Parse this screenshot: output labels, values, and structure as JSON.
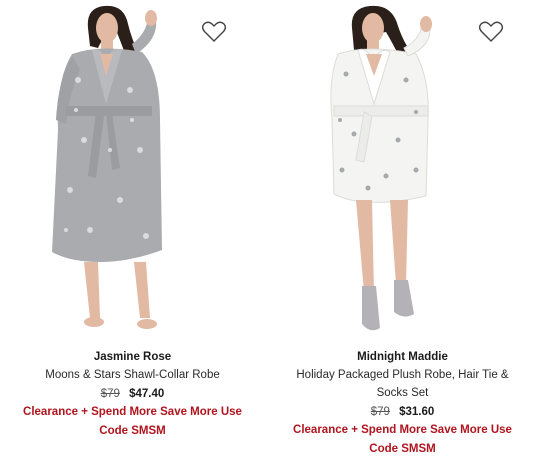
{
  "products": [
    {
      "brand": "Jasmine Rose",
      "name": "Moons & Stars Shawl-Collar Robe",
      "price_was": "$79",
      "price_now": "$47.40",
      "promo_line1": "Clearance + Spend More Save More Use",
      "promo_line2": "Code SMSM",
      "favorite_icon": "heart-outline-icon"
    },
    {
      "brand": "Midnight Maddie",
      "name_line1": "Holiday Packaged Plush Robe, Hair Tie &",
      "name_line2": "Socks Set",
      "price_was": "$79",
      "price_now": "$31.60",
      "promo_line1": "Clearance + Spend More Save More Use",
      "promo_line2": "Code SMSM",
      "favorite_icon": "heart-outline-icon"
    }
  ],
  "colors": {
    "promo_red": "#b0141e",
    "robe_gray": "#a9abae",
    "robe_white": "#f4f4f2"
  }
}
